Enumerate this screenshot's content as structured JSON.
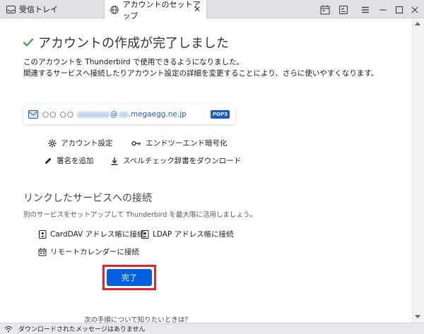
{
  "tabs": [
    {
      "label": "受信トレイ",
      "icon": "inbox-icon",
      "active": false
    },
    {
      "label": "アカウントのセットアップ",
      "icon": "globe-icon",
      "active": true
    }
  ],
  "page": {
    "title": "アカウントの作成が完了しました",
    "description_line1": "このアカウントを Thunderbird で使用できるようになりました。",
    "description_line2": "関連するサービスへ接続したりアカウント設定の詳細を変更することにより、さらに使いやすくなります。"
  },
  "account": {
    "name_prefix": "○○ ○○",
    "at": "@",
    "domain": ".megaegg.ne.jp",
    "protocol_badge": "POP3"
  },
  "actions": {
    "account_settings": "アカウント設定",
    "e2e_encryption": "エンドツーエンド暗号化",
    "add_signature": "署名を追加",
    "download_dictionary": "スペルチェック辞書をダウンロード"
  },
  "linked_services": {
    "title": "リンクしたサービスへの接続",
    "description": "別のサービスをセットアップして Thunderbird を最大限に活用しましょう。",
    "carddav": "CardDAV アドレス帳に接続",
    "ldap": "LDAP アドレス帳に接続",
    "calendar": "リモートカレンダーに接続"
  },
  "done_button": "完了",
  "next_steps": "次の手順について知りたいときは？",
  "status_bar": "ダウンロードされたメッセージはありません",
  "colors": {
    "accent": "#0060df",
    "highlight_outline": "#e0262a",
    "check": "#2aa54a"
  }
}
